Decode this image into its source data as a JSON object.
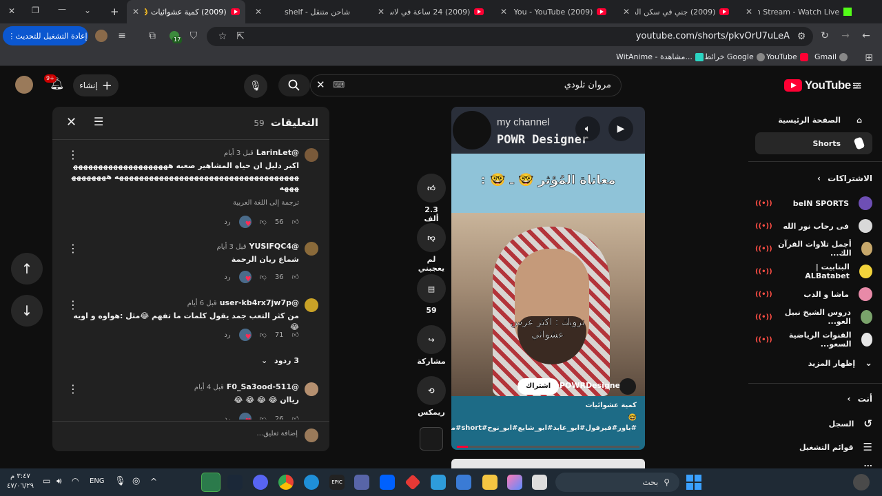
{
  "browser": {
    "tabs": [
      {
        "title": "a8sm Stream - Watch Live"
      },
      {
        "title": "(2009) جني في سكن الطالبا"
      },
      {
        "title": "(2009) Over You - YouTube"
      },
      {
        "title": "(2009) 24 ساعة في لاس فيغ"
      },
      {
        "title": "شاحن متنقل - shelf"
      },
      {
        "title": "(2009) كمية عشوائيات 🤓 !#"
      }
    ],
    "url": "youtube.com/shorts/pkvOrU7uLeA",
    "update_button": "إعادة التشغيل للتحديث",
    "extension_badge": "17",
    "bookmarks": [
      "Gmail",
      "YouTube",
      "خرائط Google",
      "WitAnime - مشاهدة..."
    ]
  },
  "header": {
    "logo_text": "YouTube",
    "region": "SA",
    "search_value": "مروان تلودي",
    "create_label": "إنشاء",
    "notif_badge": "9+"
  },
  "sidebar": {
    "main": [
      {
        "label": "الصفحة الرئيسية",
        "icon": "home-icon"
      },
      {
        "label": "Shorts",
        "icon": "shorts-icon"
      }
    ],
    "subs_heading": "الاشتراكات",
    "subscriptions": [
      {
        "name": "beIN SPORTS",
        "color": "#6e4fb5"
      },
      {
        "name": "فى رحاب نور الله",
        "color": "#d8d8d8"
      },
      {
        "name": "أجمل تلاوات القرآن الك...",
        "color": "#c7a86b"
      },
      {
        "name": "البتابيت | ALBatabet",
        "color": "#f2d33b"
      },
      {
        "name": "ماشا و الدب",
        "color": "#e88aa8"
      },
      {
        "name": "دروس الشيخ نبيل العو...",
        "color": "#7aa36b"
      },
      {
        "name": "القنوات الرياضية السعو...",
        "color": "#e6e6e6"
      }
    ],
    "show_more": "إظهار المزيد",
    "you_heading": "أنت",
    "you_items": [
      {
        "label": "السجل"
      },
      {
        "label": "قوائم التشغيل"
      },
      {
        "label": "..."
      }
    ]
  },
  "short": {
    "channel_banner": "my channel",
    "banner_title": "POWR Designer",
    "caption_top": "معاناة المُؤثر 🤓 ـ 🤓 :",
    "overlay_text": "نرويك : اكثر عرس عشوائي",
    "channel": "@POWRDesigner",
    "subscribe": "اشتراك",
    "title": "كمية عشوائيات",
    "hashtags": "🤓 #باور#فيرفول#ابو_عابد#ابو_شايع#ابو_نوح#short#مجرم#باور_الافضل#shongxbong"
  },
  "actions": {
    "like_count": "2.3 ألف",
    "dislike_label": "لم يعجبني",
    "comments_count": "59",
    "share_label": "مشاركة",
    "remix_label": "ريمكس"
  },
  "comments": {
    "title": "التعليقات",
    "count": "59",
    "items": [
      {
        "author": "@LarinLet",
        "time": "قبل 3 أيام",
        "text": "اكبر دليل ان حياه المشاهير صعبه ههههههههههههههههههههههههههههههههههههههههههههههههههههههههه هههههههههههه",
        "translate": "ترجمة إلى اللغة العربية",
        "likes": "56",
        "reply": "رد",
        "avatar_color": "#7a5a3a"
      },
      {
        "author": "@YUSIFQC4",
        "time": "قبل 3 أيام",
        "text": "شماع ريان الرحمة",
        "likes": "36",
        "reply": "رد",
        "avatar_color": "#8a6a3a"
      },
      {
        "author": "@user-kb4rx7jw7p",
        "time": "قبل 6 أيام",
        "text": "من كثر التعب جمد يقول كلمات ما تفهم 😂مثل :هواوه و اويه😂",
        "likes": "71",
        "reply": "رد",
        "replies": "3 ردود",
        "avatar_color": "#c9a227"
      },
      {
        "author": "@F0_Sa3ood-511",
        "time": "قبل 4 أيام",
        "text": "رياان 😂 😂 😂 😂",
        "likes": "26",
        "reply": "رد",
        "avatar_color": "#b59070"
      }
    ],
    "add_placeholder": "إضافة تعليق..."
  },
  "taskbar": {
    "search_label": "بحث",
    "lang": "ENG",
    "time": "٣:٤٧ م",
    "date": "٤٧/٠٦/٢٩"
  }
}
